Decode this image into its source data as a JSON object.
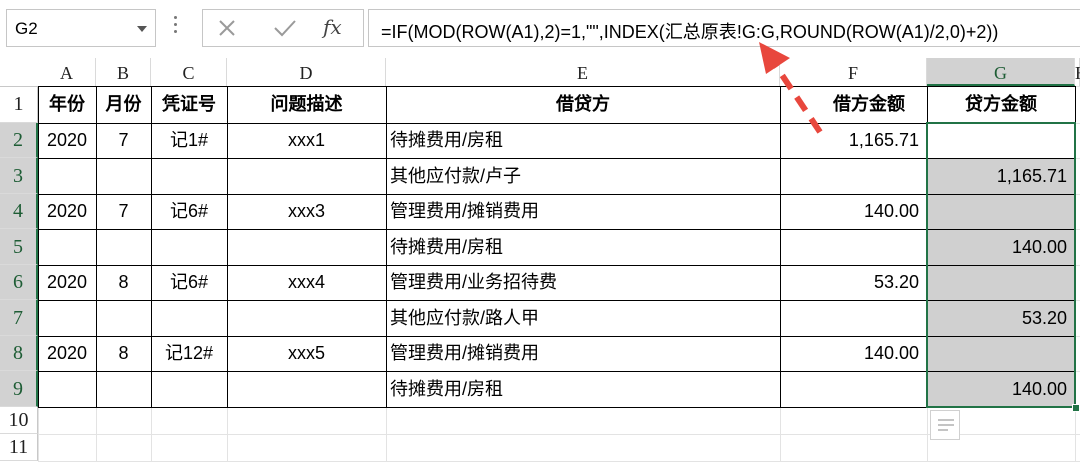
{
  "formula_bar": {
    "name_box": "G2",
    "formula_prefix": "=IF(MOD(ROW(A1),2)=1,\"\",INDEX(",
    "formula_sheet": "汇总原表",
    "formula_suffix": "!G:G,ROUND(ROW(A1)/2,0)+2))",
    "fx_label": "fx"
  },
  "columns": [
    "A",
    "B",
    "C",
    "D",
    "E",
    "F",
    "G",
    "H"
  ],
  "rows": [
    "1",
    "2",
    "3",
    "4",
    "5",
    "6",
    "7",
    "8",
    "9",
    "10",
    "11"
  ],
  "header_row": [
    "年份",
    "月份",
    "凭证号",
    "问题描述",
    "借贷方",
    "借方金额",
    "贷方金额"
  ],
  "data_rows": [
    {
      "year": "2020",
      "month": "7",
      "voucher": "记1#",
      "desc": "xxx1",
      "account": "待摊费用/房租",
      "debit": "1,165.71",
      "credit": ""
    },
    {
      "year": "",
      "month": "",
      "voucher": "",
      "desc": "",
      "account": "其他应付款/卢子",
      "debit": "",
      "credit": "1,165.71"
    },
    {
      "year": "2020",
      "month": "7",
      "voucher": "记6#",
      "desc": "xxx3",
      "account": "管理费用/摊销费用",
      "debit": "140.00",
      "credit": ""
    },
    {
      "year": "",
      "month": "",
      "voucher": "",
      "desc": "",
      "account": "待摊费用/房租",
      "debit": "",
      "credit": "140.00"
    },
    {
      "year": "2020",
      "month": "8",
      "voucher": "记6#",
      "desc": "xxx4",
      "account": "管理费用/业务招待费",
      "debit": "53.20",
      "credit": ""
    },
    {
      "year": "",
      "month": "",
      "voucher": "",
      "desc": "",
      "account": "其他应付款/路人甲",
      "debit": "",
      "credit": "53.20"
    },
    {
      "year": "2020",
      "month": "8",
      "voucher": "记12#",
      "desc": "xxx5",
      "account": "管理费用/摊销费用",
      "debit": "140.00",
      "credit": ""
    },
    {
      "year": "",
      "month": "",
      "voucher": "",
      "desc": "",
      "account": "待摊费用/房租",
      "debit": "",
      "credit": "140.00"
    }
  ],
  "colors": {
    "selection": "#217346",
    "selected_fill": "#d0d0d0",
    "arrow": "#e8473d"
  }
}
